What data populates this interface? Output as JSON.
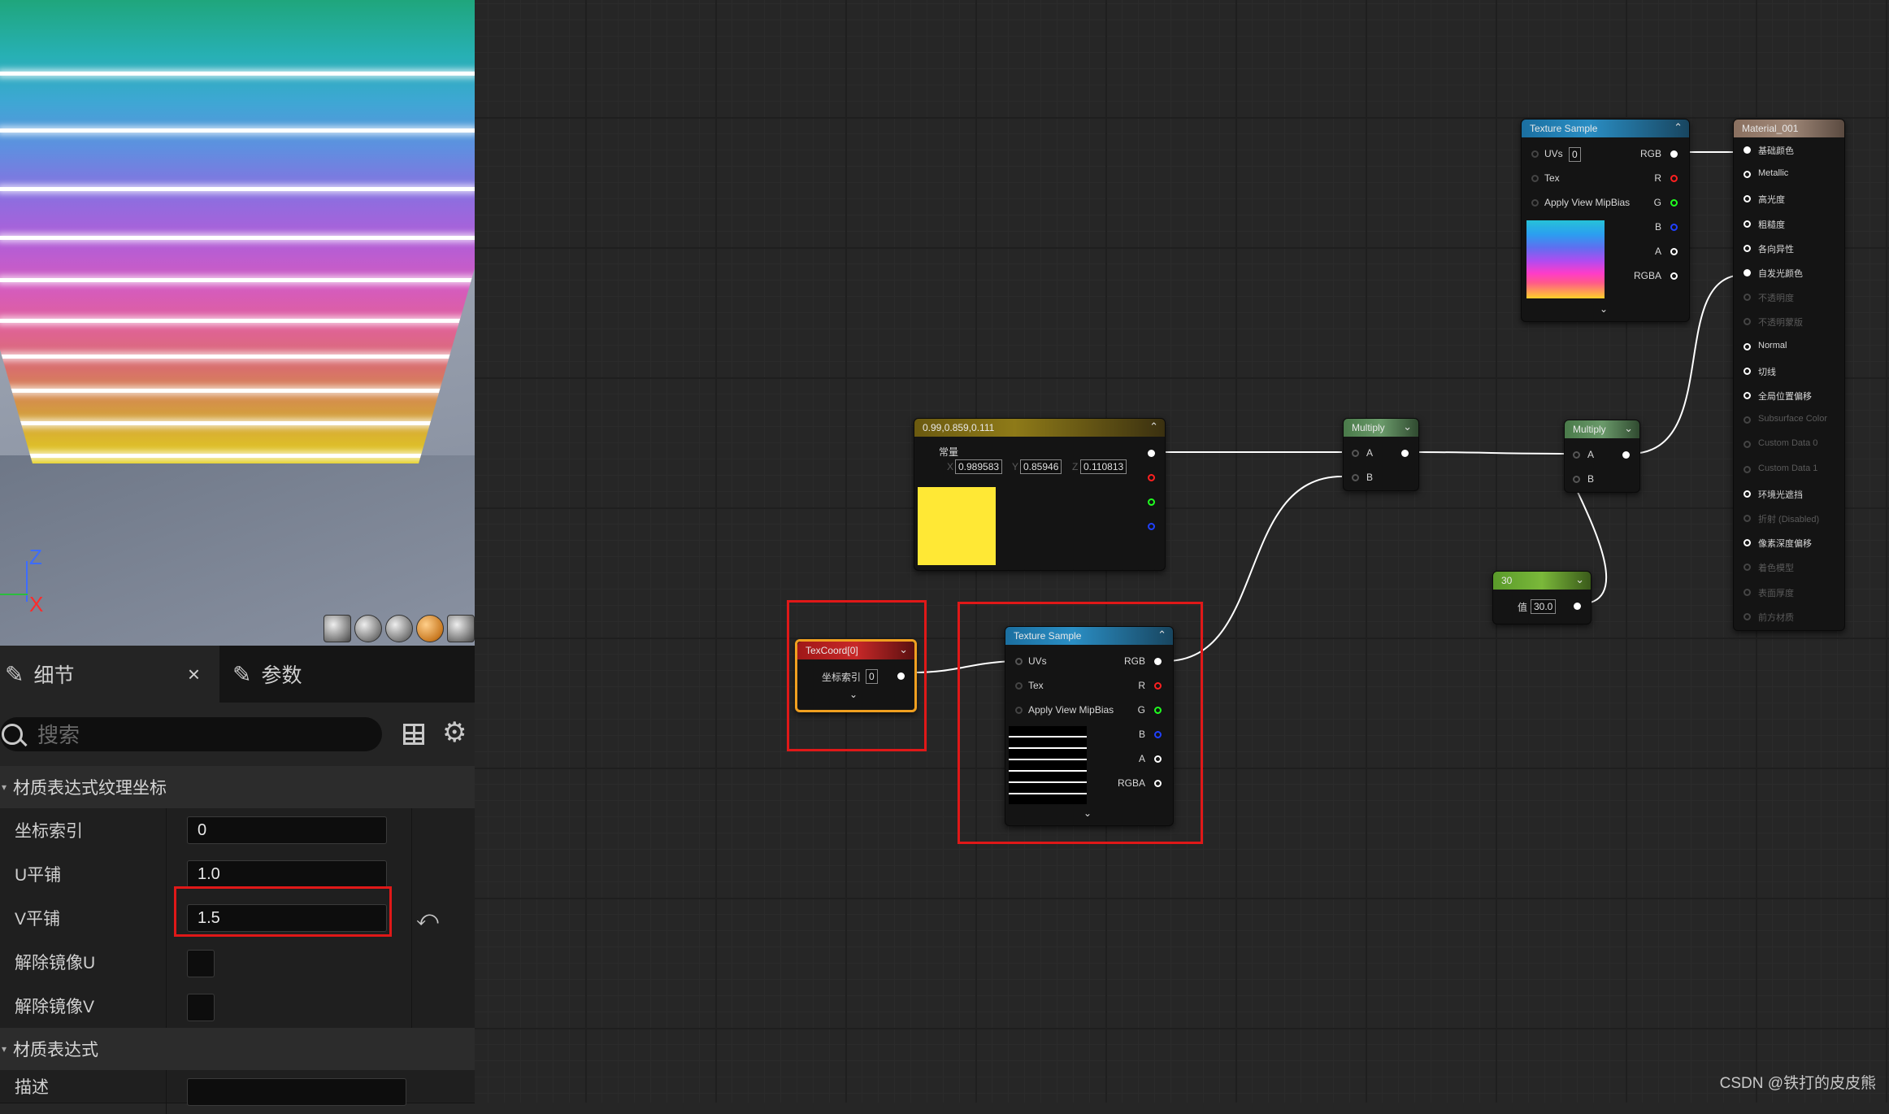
{
  "viewport": {
    "axis_z": "Z",
    "axis_x": "X"
  },
  "details_panel": {
    "tabs": [
      {
        "label": "细节"
      },
      {
        "label": "参数"
      }
    ],
    "close_glyph": "×",
    "search": {
      "placeholder": "搜索",
      "value": ""
    },
    "sections": [
      {
        "title": "材质表达式纹理坐标"
      },
      {
        "title": "材质表达式"
      }
    ],
    "properties": [
      {
        "label": "坐标索引",
        "value": "0",
        "type": "number"
      },
      {
        "label": "U平铺",
        "value": "1.0",
        "type": "number"
      },
      {
        "label": "V平铺",
        "value": "1.5",
        "type": "number",
        "highlighted": true,
        "reset_glyph": "⤺"
      },
      {
        "label": "解除镜像U",
        "checked": false,
        "type": "checkbox"
      },
      {
        "label": "解除镜像V",
        "checked": false,
        "type": "checkbox"
      },
      {
        "label": "描述",
        "value": "",
        "type": "text"
      }
    ]
  },
  "graph": {
    "nodes": {
      "texture_sample_top": {
        "title": "Texture Sample",
        "inputs": [
          "UVs",
          "Tex",
          "Apply View MipBias"
        ],
        "uv_index": "0",
        "outputs": [
          "RGB",
          "R",
          "G",
          "B",
          "A",
          "RGBA"
        ]
      },
      "constant3": {
        "title": "0.99,0.859,0.111",
        "label": "常量",
        "x_label": "X",
        "x": "0.989583",
        "y_label": "Y",
        "y": "0.85946",
        "z_label": "Z",
        "z": "0.110813",
        "swatch_color": "#ffe835"
      },
      "multiply_1": {
        "title": "Multiply",
        "inputs": [
          "A",
          "B"
        ]
      },
      "multiply_2": {
        "title": "Multiply",
        "inputs": [
          "A",
          "B"
        ]
      },
      "scalar": {
        "title": "30",
        "label": "值",
        "value": "30.0"
      },
      "texcoord": {
        "title": "TexCoord[0]",
        "label": "坐标索引",
        "value": "0"
      },
      "texture_sample_mid": {
        "title": "Texture Sample",
        "inputs": [
          "UVs",
          "Tex",
          "Apply View MipBias"
        ],
        "outputs": [
          "RGB",
          "R",
          "G",
          "B",
          "A",
          "RGBA"
        ]
      },
      "material": {
        "title": "Material_001",
        "pins": [
          {
            "label": "基础颜色",
            "active": true,
            "filled": true
          },
          {
            "label": "Metallic",
            "active": true
          },
          {
            "label": "高光度",
            "active": true
          },
          {
            "label": "粗糙度",
            "active": true
          },
          {
            "label": "各向异性",
            "active": true
          },
          {
            "label": "自发光颜色",
            "active": true,
            "filled": true
          },
          {
            "label": "不透明度",
            "active": false
          },
          {
            "label": "不透明蒙版",
            "active": false
          },
          {
            "label": "Normal",
            "active": true
          },
          {
            "label": "切线",
            "active": true
          },
          {
            "label": "全局位置偏移",
            "active": true
          },
          {
            "label": "Subsurface Color",
            "active": false
          },
          {
            "label": "Custom Data 0",
            "active": false
          },
          {
            "label": "Custom Data 1",
            "active": false
          },
          {
            "label": "环境光遮挡",
            "active": true
          },
          {
            "label": "折射 (Disabled)",
            "active": false
          },
          {
            "label": "像素深度偏移",
            "active": true
          },
          {
            "label": "着色模型",
            "active": false
          },
          {
            "label": "表面厚度",
            "active": false
          },
          {
            "label": "前方材质",
            "active": false
          }
        ]
      }
    }
  },
  "watermark": "CSDN @铁打的皮皮熊",
  "colors": {
    "highlight_red": "#e01818",
    "selected_orange": "#f0a020",
    "constant_yellow": "#ffe835"
  }
}
